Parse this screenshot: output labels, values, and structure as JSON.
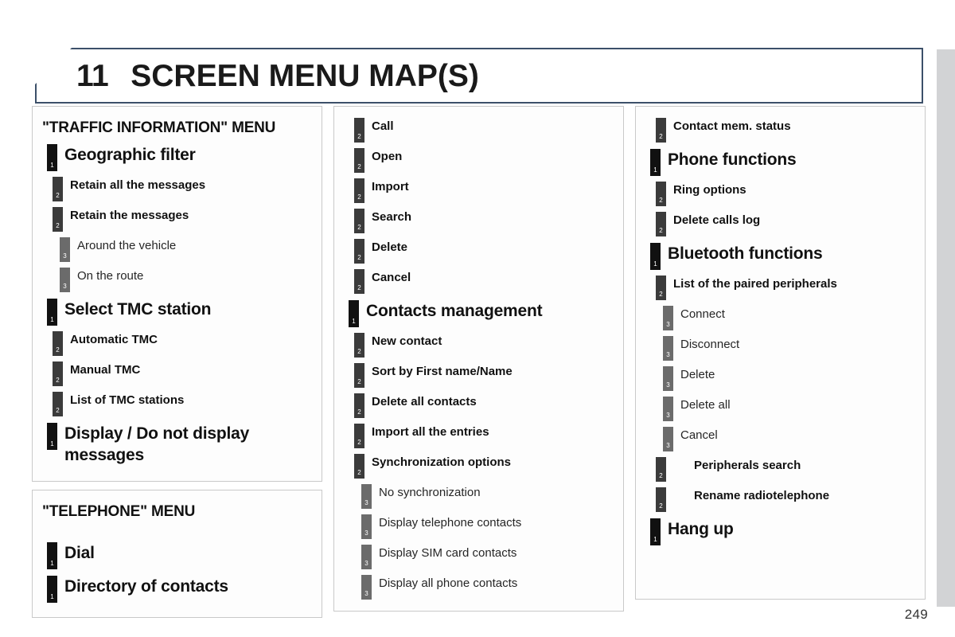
{
  "page": {
    "chapter_number": "11",
    "chapter_title": "SCREEN MENU MAP(S)",
    "page_number": "249"
  },
  "columns": [
    {
      "panels": [
        {
          "title": "\"TRAFFIC INFORMATION\" MENU",
          "entries": [
            {
              "level": 1,
              "label": "Geographic filter"
            },
            {
              "level": 2,
              "label": "Retain all the messages"
            },
            {
              "level": 2,
              "label": "Retain the messages"
            },
            {
              "level": 3,
              "label": "Around the vehicle"
            },
            {
              "level": 3,
              "label": "On the route"
            },
            {
              "level": 1,
              "label": "Select TMC station"
            },
            {
              "level": 2,
              "label": "Automatic TMC"
            },
            {
              "level": 2,
              "label": "Manual TMC"
            },
            {
              "level": 2,
              "label": "List of TMC stations"
            },
            {
              "level": 1,
              "label": "Display / Do not display messages"
            }
          ]
        },
        {
          "title": "\"TELEPHONE\" MENU",
          "entries": [
            {
              "level": 1,
              "label": "Dial"
            },
            {
              "level": 1,
              "label": "Directory of contacts"
            }
          ]
        }
      ]
    },
    {
      "panels": [
        {
          "title": "",
          "entries": [
            {
              "level": 2,
              "label": "Call"
            },
            {
              "level": 2,
              "label": "Open"
            },
            {
              "level": 2,
              "label": "Import"
            },
            {
              "level": 2,
              "label": "Search"
            },
            {
              "level": 2,
              "label": "Delete"
            },
            {
              "level": 2,
              "label": "Cancel"
            },
            {
              "level": 1,
              "label": "Contacts management"
            },
            {
              "level": 2,
              "label": "New contact"
            },
            {
              "level": 2,
              "label": "Sort by First name/Name"
            },
            {
              "level": 2,
              "label": "Delete all contacts"
            },
            {
              "level": 2,
              "label": "Import all the entries"
            },
            {
              "level": 2,
              "label": "Synchronization options"
            },
            {
              "level": 3,
              "label": "No synchronization"
            },
            {
              "level": 3,
              "label": "Display telephone contacts"
            },
            {
              "level": 3,
              "label": "Display SIM card contacts"
            },
            {
              "level": 3,
              "label": "Display all phone contacts"
            }
          ]
        }
      ]
    },
    {
      "panels": [
        {
          "title": "",
          "entries": [
            {
              "level": 2,
              "label": "Contact mem. status"
            },
            {
              "level": 1,
              "label": "Phone functions"
            },
            {
              "level": 2,
              "label": "Ring options"
            },
            {
              "level": 2,
              "label": "Delete calls log"
            },
            {
              "level": 1,
              "label": "Bluetooth functions"
            },
            {
              "level": 2,
              "label": "List of the paired peripherals"
            },
            {
              "level": 3,
              "label": "Connect"
            },
            {
              "level": 3,
              "label": "Disconnect"
            },
            {
              "level": 3,
              "label": "Delete"
            },
            {
              "level": 3,
              "label": "Delete all"
            },
            {
              "level": 3,
              "label": "Cancel"
            },
            {
              "level": 2,
              "deep": true,
              "label": "Peripherals search"
            },
            {
              "level": 2,
              "deep": true,
              "label": "Rename radiotelephone"
            },
            {
              "level": 1,
              "label": "Hang up"
            }
          ]
        }
      ]
    }
  ],
  "markers": {
    "level1_text": "1",
    "level2_text": "2",
    "level3_text": "3",
    "level1_color": "#111111",
    "level2_color": "#3b3b3b",
    "level3_color": "#6b6b6b"
  },
  "theme": {
    "banner_border": "#3c5069",
    "panel_border": "#c9c9c9",
    "edge_stripe": "#d2d3d5"
  }
}
